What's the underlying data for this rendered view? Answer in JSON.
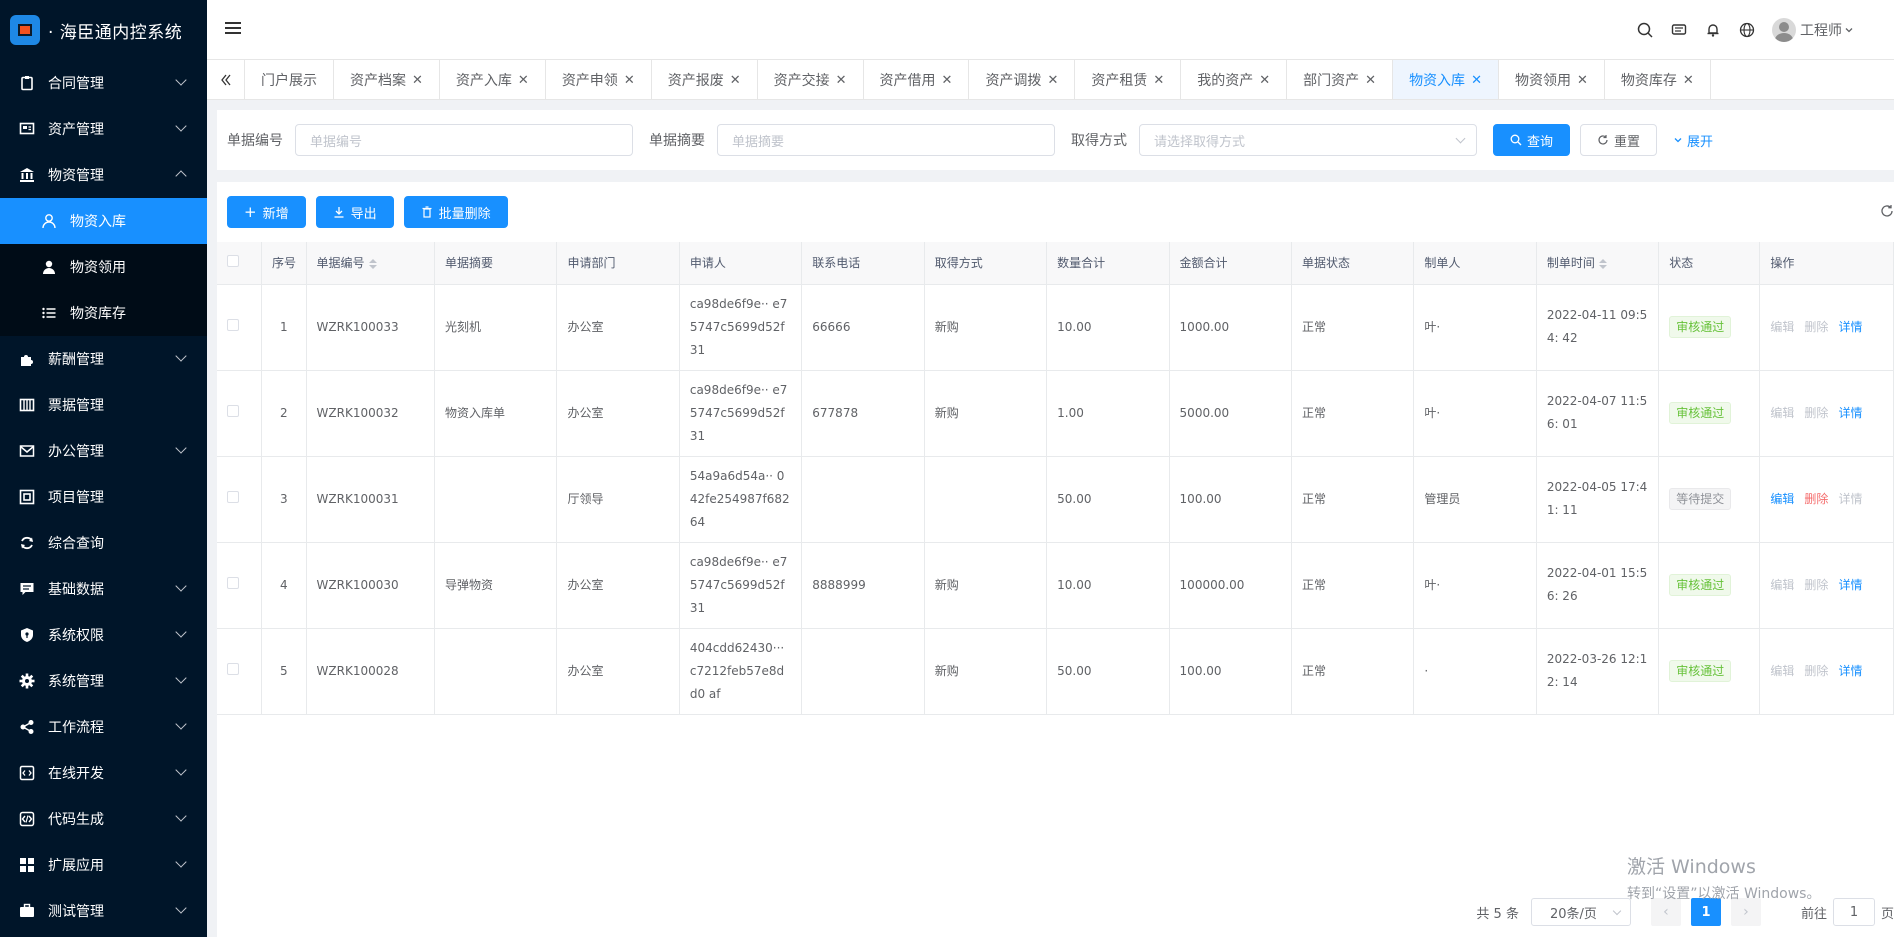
{
  "app": {
    "title": "· 海臣通内控系统"
  },
  "sidebar": {
    "items": [
      {
        "label": "合同管理",
        "icon": "clipboard-icon",
        "expandable": true
      },
      {
        "label": "资产管理",
        "icon": "monitor-icon",
        "expandable": true
      },
      {
        "label": "物资管理",
        "icon": "bank-icon",
        "expandable": true,
        "expanded": true
      },
      {
        "label": "薪酬管理",
        "icon": "puzzle-icon",
        "expandable": true
      },
      {
        "label": "票据管理",
        "icon": "ticket-icon",
        "expandable": false
      },
      {
        "label": "办公管理",
        "icon": "mail-icon",
        "expandable": true
      },
      {
        "label": "项目管理",
        "icon": "project-icon",
        "expandable": false
      },
      {
        "label": "综合查询",
        "icon": "sync-icon",
        "expandable": false
      },
      {
        "label": "基础数据",
        "icon": "message-icon",
        "expandable": true
      },
      {
        "label": "系统权限",
        "icon": "shield-icon",
        "expandable": true
      },
      {
        "label": "系统管理",
        "icon": "gear-icon",
        "expandable": true
      },
      {
        "label": "工作流程",
        "icon": "share-icon",
        "expandable": true
      },
      {
        "label": "在线开发",
        "icon": "code-square-icon",
        "expandable": true
      },
      {
        "label": "代码生成",
        "icon": "code-icon",
        "expandable": true
      },
      {
        "label": "扩展应用",
        "icon": "grid-icon",
        "expandable": true
      },
      {
        "label": "测试管理",
        "icon": "briefcase-icon",
        "expandable": true
      }
    ],
    "submenu": [
      {
        "label": "物资入库",
        "icon": "user-icon",
        "active": true
      },
      {
        "label": "物资领用",
        "icon": "users-icon",
        "active": false
      },
      {
        "label": "物资库存",
        "icon": "list-icon",
        "active": false
      }
    ]
  },
  "header": {
    "user_name": "工程师"
  },
  "tabs": [
    {
      "label": "门户展示",
      "closable": false
    },
    {
      "label": "资产档案",
      "closable": true
    },
    {
      "label": "资产入库",
      "closable": true
    },
    {
      "label": "资产申领",
      "closable": true
    },
    {
      "label": "资产报废",
      "closable": true
    },
    {
      "label": "资产交接",
      "closable": true
    },
    {
      "label": "资产借用",
      "closable": true
    },
    {
      "label": "资产调拨",
      "closable": true
    },
    {
      "label": "资产租赁",
      "closable": true
    },
    {
      "label": "我的资产",
      "closable": true
    },
    {
      "label": "部门资产",
      "closable": true
    },
    {
      "label": "物资入库",
      "closable": true,
      "active": true
    },
    {
      "label": "物资领用",
      "closable": true
    },
    {
      "label": "物资库存",
      "closable": true
    }
  ],
  "search": {
    "doc_no_label": "单据编号",
    "doc_no_placeholder": "单据编号",
    "summary_label": "单据摘要",
    "summary_placeholder": "单据摘要",
    "method_label": "取得方式",
    "method_placeholder": "请选择取得方式",
    "query_label": "查询",
    "reset_label": "重置",
    "expand_label": "展开"
  },
  "toolbar": {
    "add_label": "新增",
    "export_label": "导出",
    "batch_delete_label": "批量删除"
  },
  "table": {
    "columns": [
      "序号",
      "单据编号",
      "单据摘要",
      "申请部门",
      "申请人",
      "联系电话",
      "取得方式",
      "数量合计",
      "金额合计",
      "单据状态",
      "制单人",
      "制单时间",
      "状态",
      "操作"
    ],
    "rows": [
      {
        "index": "1",
        "doc_no": "WZRK100033",
        "summary": "光刻机",
        "dept": "办公室",
        "applicant": "ca98de6f9e·· e75747c5699d52f 31",
        "phone": "66666",
        "method": "新购",
        "qty": "10.00",
        "amount": "1000.00",
        "doc_status": "正常",
        "creator": "叶·",
        "time": "2022-04-11 09:54: 42",
        "status": "审核通过",
        "status_type": "ok",
        "ops": [
          {
            "label": "编辑",
            "style": "dis"
          },
          {
            "label": "删除",
            "style": "dis"
          },
          {
            "label": "详情",
            "style": "blue"
          }
        ]
      },
      {
        "index": "2",
        "doc_no": "WZRK100032",
        "summary": "物资入库单",
        "dept": "办公室",
        "applicant": "ca98de6f9e·· e75747c5699d52f 31",
        "phone": "677878",
        "method": "新购",
        "qty": "1.00",
        "amount": "5000.00",
        "doc_status": "正常",
        "creator": "叶·",
        "time": "2022-04-07 11:56: 01",
        "status": "审核通过",
        "status_type": "ok",
        "ops": [
          {
            "label": "编辑",
            "style": "dis"
          },
          {
            "label": "删除",
            "style": "dis"
          },
          {
            "label": "详情",
            "style": "blue"
          }
        ]
      },
      {
        "index": "3",
        "doc_no": "WZRK100031",
        "summary": "",
        "dept": "厅领导",
        "applicant": "54a9a6d54a·· 042fe254987f682 64",
        "phone": "",
        "method": "",
        "qty": "50.00",
        "amount": "100.00",
        "doc_status": "正常",
        "creator": "管理员",
        "time": "2022-04-05 17:41: 11",
        "status": "等待提交",
        "status_type": "wait",
        "ops": [
          {
            "label": "编辑",
            "style": "blue"
          },
          {
            "label": "删除",
            "style": "red"
          },
          {
            "label": "详情",
            "style": "dis"
          }
        ]
      },
      {
        "index": "4",
        "doc_no": "WZRK100030",
        "summary": "导弹物资",
        "dept": "办公室",
        "applicant": "ca98de6f9e·· e75747c5699d52f 31",
        "phone": "8888999",
        "method": "新购",
        "qty": "10.00",
        "amount": "100000.00",
        "doc_status": "正常",
        "creator": "叶·",
        "time": "2022-04-01 15:56: 26",
        "status": "审核通过",
        "status_type": "ok",
        "ops": [
          {
            "label": "编辑",
            "style": "dis"
          },
          {
            "label": "删除",
            "style": "dis"
          },
          {
            "label": "详情",
            "style": "blue"
          }
        ]
      },
      {
        "index": "5",
        "doc_no": "WZRK100028",
        "summary": "",
        "dept": "办公室",
        "applicant": "404cdd62430··· c7212feb57e8dd0 af",
        "phone": "",
        "method": "新购",
        "qty": "50.00",
        "amount": "100.00",
        "doc_status": "正常",
        "creator": "·",
        "time": "2022-03-26 12:12: 14",
        "status": "审核通过",
        "status_type": "ok",
        "ops": [
          {
            "label": "编辑",
            "style": "dis"
          },
          {
            "label": "删除",
            "style": "dis"
          },
          {
            "label": "详情",
            "style": "blue"
          }
        ]
      }
    ]
  },
  "pagination": {
    "total_text": "共 5 条",
    "page_size": "20条/页",
    "current_page": "1",
    "goto_label": "前往",
    "goto_value": "1",
    "page_unit": "页"
  },
  "watermark": {
    "line1": "激活 Windows",
    "line2": "转到“设置”以激活 Windows。"
  }
}
